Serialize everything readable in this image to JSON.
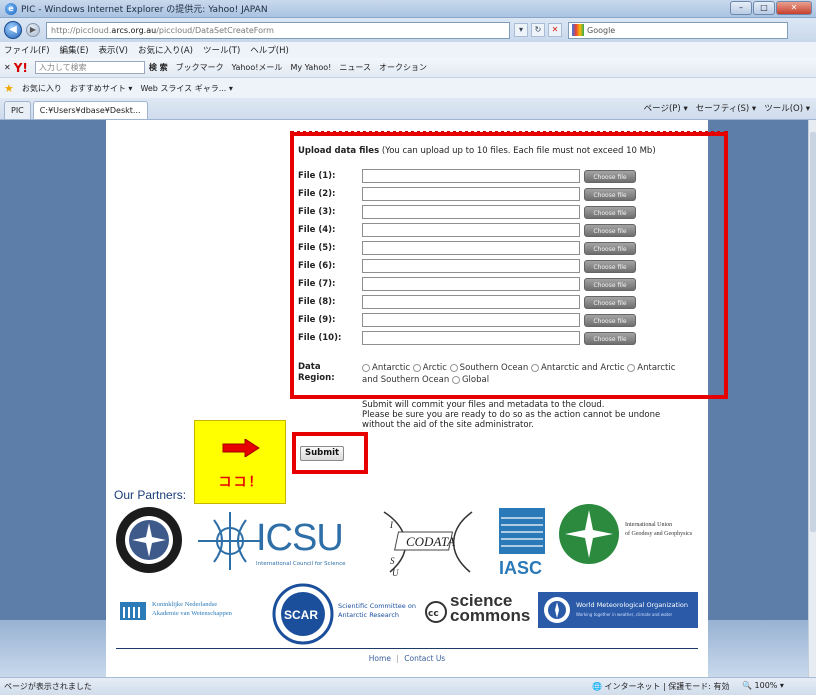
{
  "window": {
    "title": "PIC - Windows Internet Explorer の提供元: Yahoo! JAPAN",
    "buttons": [
      "–",
      "□",
      "✕"
    ]
  },
  "address": {
    "url_pre": "http://piccloud.",
    "url_domain": "arcs.org.au",
    "url_path": "/piccloud/DataSetCreateForm",
    "search_engine": "Google"
  },
  "menu": [
    "ファイル(F)",
    "編集(E)",
    "表示(V)",
    "お気に入り(A)",
    "ツール(T)",
    "ヘルプ(H)"
  ],
  "yahoo_toolbar": {
    "search_placeholder": "入力して検索",
    "search_label": "検 索",
    "items": [
      "ブックマーク",
      "Yahoo!メール",
      "My Yahoo!",
      "ニュース",
      "オークション"
    ]
  },
  "favorites": {
    "label": "お気に入り",
    "items": [
      "おすすめサイト ▾",
      "Web スライス ギャラ... ▾"
    ]
  },
  "tabs": [
    {
      "label": "PIC",
      "active": false
    },
    {
      "label": "C:¥Users¥dbase¥Deskt...",
      "active": true
    }
  ],
  "tab_tools": [
    "ページ(P) ▾",
    "セーフティ(S) ▾",
    "ツール(O) ▾"
  ],
  "form": {
    "upload_title_bold": "Upload data files",
    "upload_title_note": " (You can upload up to 10 files. Each file must not exceed 10 Mb)",
    "file_labels": [
      "File (1):",
      "File (2):",
      "File (3):",
      "File (4):",
      "File (5):",
      "File (6):",
      "File (7):",
      "File (8):",
      "File (9):",
      "File (10):"
    ],
    "choose_file_label": "Choose file",
    "region_label_1": "Data",
    "region_label_2": "Region:",
    "regions": [
      "Antarctic",
      "Arctic",
      "Southern Ocean",
      "Antarctic and Arctic",
      "Antarctic and Southern Ocean",
      "Global"
    ],
    "commit_note_1": "Submit will commit your files and metadata to the cloud.",
    "commit_note_2": "Please be sure you are ready to do so as the action cannot be undone without the aid of the site administrator.",
    "submit_label": "Submit"
  },
  "callout": {
    "text": "ココ！",
    "color": "#e60000",
    "bg": "#ffff00"
  },
  "partners": {
    "title": "Our Partners:",
    "icsu_name": "ICSU",
    "icsu_sub": "International Council for Science",
    "codata": "CODATA",
    "iasc": "IASC",
    "iugg_1": "International Union",
    "iugg_2": "of Geodesy and Geophysics",
    "knaw_1": "Koninklijke Nederlandse",
    "knaw_2": "Akademie van Wetenschappen",
    "scar": "SCAR",
    "scar_name_1": "Scientific Committee on",
    "scar_name_2": "Antarctic Research",
    "sc_1": "science",
    "sc_2": "commons",
    "wmo": "World Meteorological Organization",
    "wmo_sub": "Working together in weather, climate and water"
  },
  "footer": {
    "home": "Home",
    "sep": "|",
    "contact": "Contact Us"
  },
  "status": {
    "left": "ページが表示されました",
    "zone": "インターネット | 保護モード: 有効",
    "zoom": "100%"
  }
}
